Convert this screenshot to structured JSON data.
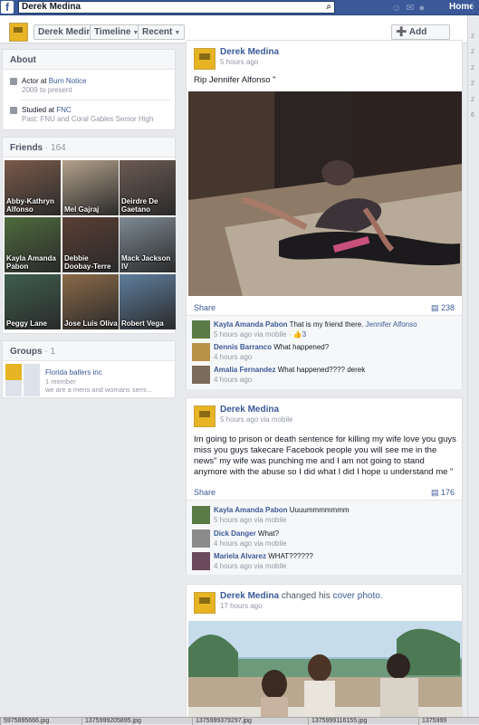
{
  "topbar": {
    "logo": "f",
    "search_value": "Derek Medina",
    "search_icon": "search-icon",
    "home_label": "Home"
  },
  "profile_bar": {
    "name": "Derek Medina",
    "timeline": "Timeline",
    "recent": "Recent",
    "add_friend": "Add Friend"
  },
  "about": {
    "title": "About",
    "rows": [
      {
        "text_pre": "Actor at ",
        "text_link": "Burn Notice",
        "sub": "2009 to present",
        "icon": "briefcase-icon"
      },
      {
        "text_pre": "Studied at ",
        "text_link": "FNC",
        "sub": "Past: FNU and Coral Gables Senior High",
        "icon": "graduation-cap-icon"
      }
    ]
  },
  "friends": {
    "title": "Friends",
    "count": "· 164",
    "people": [
      {
        "name": "Abby-Kathryn Alfonso",
        "color": "#7a5a4a"
      },
      {
        "name": "Mel Gajraj",
        "color": "#b4a28c"
      },
      {
        "name": "Deirdre De Gaetano",
        "color": "#6b5a52"
      },
      {
        "name": "Kayla Amanda Pabon",
        "color": "#4f6b3d"
      },
      {
        "name": "Debbie Doobay-Terre",
        "color": "#5a3e34"
      },
      {
        "name": "Mack Jackson IV",
        "color": "#7e8a94"
      },
      {
        "name": "Peggy Lane",
        "color": "#3e5e4f"
      },
      {
        "name": "Jose Luis Oliva",
        "color": "#8b6a48"
      },
      {
        "name": "Robert Vega",
        "color": "#5f7e9e"
      }
    ]
  },
  "groups": {
    "title": "Groups",
    "count": "· 1",
    "name": "Florida ballers inc",
    "members": "1 member",
    "desc": "we are a mens and womans semi..."
  },
  "posts": [
    {
      "author": "Derek Medina",
      "time": "5 hours ago",
      "text": "Rip Jennifer Alfonso \"",
      "share": "Share",
      "share_count": "238",
      "comments": [
        {
          "name": "Kayla Amanda Pabon",
          "text": "That is my friend there.",
          "link": "Jennifer Alfonso",
          "meta": "5 hours ago via mobile · ",
          "likes": "3",
          "avatar": "#5a7a46"
        },
        {
          "name": "Dennis Barranco",
          "text": "What happened?",
          "meta": "4 hours ago",
          "avatar": "#b9924a"
        },
        {
          "name": "Amalia Fernandez",
          "text": "What happened???? derek",
          "meta": "4 hours ago",
          "avatar": "#7b6b5c"
        }
      ]
    },
    {
      "author": "Derek Medina",
      "time": "5 hours ago via mobile",
      "text": "Im going to prison or death sentence for killing my wife love you guys miss you guys takecare Facebook people you will see me in the news\" my wife was punching me and I am not going to stand anymore with the abuse so I did what I did I hope u understand me \"",
      "share": "Share",
      "share_count": "176",
      "comments": [
        {
          "name": "Kayla Amanda Pabon",
          "text": "Uuuummmmmmm",
          "meta": "5 hours ago via mobile",
          "avatar": "#5a7a46"
        },
        {
          "name": "Dick Danger",
          "text": "What?",
          "meta": "4 hours ago via mobile",
          "avatar": "#8b8b8b"
        },
        {
          "name": "Mariela Alvarez",
          "text": "WHAT??????",
          "meta": "4 hours ago via mobile",
          "avatar": "#6a4a5a"
        }
      ]
    },
    {
      "author": "Derek Medina",
      "action_pre": "changed his",
      "action_link": "cover photo",
      "action_end": ".",
      "time": "17 hours ago"
    }
  ],
  "downloads": [
    "5975895666.jpg",
    "1375999205895.jpg",
    "1375999379297.jpg",
    "1375999116155.jpg",
    "1375999"
  ]
}
